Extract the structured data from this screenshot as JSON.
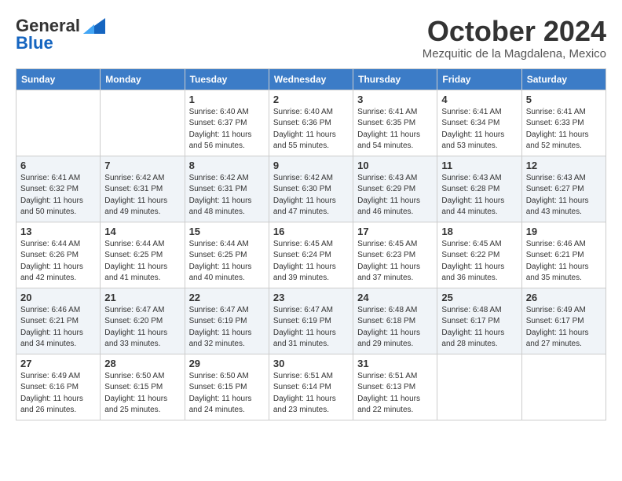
{
  "header": {
    "logo_line1": "General",
    "logo_line2": "Blue",
    "month_title": "October 2024",
    "location": "Mezquitic de la Magdalena, Mexico"
  },
  "days_of_week": [
    "Sunday",
    "Monday",
    "Tuesday",
    "Wednesday",
    "Thursday",
    "Friday",
    "Saturday"
  ],
  "weeks": [
    [
      {
        "day": "",
        "sunrise": "",
        "sunset": "",
        "daylight": ""
      },
      {
        "day": "",
        "sunrise": "",
        "sunset": "",
        "daylight": ""
      },
      {
        "day": "1",
        "sunrise": "Sunrise: 6:40 AM",
        "sunset": "Sunset: 6:37 PM",
        "daylight": "Daylight: 11 hours and 56 minutes."
      },
      {
        "day": "2",
        "sunrise": "Sunrise: 6:40 AM",
        "sunset": "Sunset: 6:36 PM",
        "daylight": "Daylight: 11 hours and 55 minutes."
      },
      {
        "day": "3",
        "sunrise": "Sunrise: 6:41 AM",
        "sunset": "Sunset: 6:35 PM",
        "daylight": "Daylight: 11 hours and 54 minutes."
      },
      {
        "day": "4",
        "sunrise": "Sunrise: 6:41 AM",
        "sunset": "Sunset: 6:34 PM",
        "daylight": "Daylight: 11 hours and 53 minutes."
      },
      {
        "day": "5",
        "sunrise": "Sunrise: 6:41 AM",
        "sunset": "Sunset: 6:33 PM",
        "daylight": "Daylight: 11 hours and 52 minutes."
      }
    ],
    [
      {
        "day": "6",
        "sunrise": "Sunrise: 6:41 AM",
        "sunset": "Sunset: 6:32 PM",
        "daylight": "Daylight: 11 hours and 50 minutes."
      },
      {
        "day": "7",
        "sunrise": "Sunrise: 6:42 AM",
        "sunset": "Sunset: 6:31 PM",
        "daylight": "Daylight: 11 hours and 49 minutes."
      },
      {
        "day": "8",
        "sunrise": "Sunrise: 6:42 AM",
        "sunset": "Sunset: 6:31 PM",
        "daylight": "Daylight: 11 hours and 48 minutes."
      },
      {
        "day": "9",
        "sunrise": "Sunrise: 6:42 AM",
        "sunset": "Sunset: 6:30 PM",
        "daylight": "Daylight: 11 hours and 47 minutes."
      },
      {
        "day": "10",
        "sunrise": "Sunrise: 6:43 AM",
        "sunset": "Sunset: 6:29 PM",
        "daylight": "Daylight: 11 hours and 46 minutes."
      },
      {
        "day": "11",
        "sunrise": "Sunrise: 6:43 AM",
        "sunset": "Sunset: 6:28 PM",
        "daylight": "Daylight: 11 hours and 44 minutes."
      },
      {
        "day": "12",
        "sunrise": "Sunrise: 6:43 AM",
        "sunset": "Sunset: 6:27 PM",
        "daylight": "Daylight: 11 hours and 43 minutes."
      }
    ],
    [
      {
        "day": "13",
        "sunrise": "Sunrise: 6:44 AM",
        "sunset": "Sunset: 6:26 PM",
        "daylight": "Daylight: 11 hours and 42 minutes."
      },
      {
        "day": "14",
        "sunrise": "Sunrise: 6:44 AM",
        "sunset": "Sunset: 6:25 PM",
        "daylight": "Daylight: 11 hours and 41 minutes."
      },
      {
        "day": "15",
        "sunrise": "Sunrise: 6:44 AM",
        "sunset": "Sunset: 6:25 PM",
        "daylight": "Daylight: 11 hours and 40 minutes."
      },
      {
        "day": "16",
        "sunrise": "Sunrise: 6:45 AM",
        "sunset": "Sunset: 6:24 PM",
        "daylight": "Daylight: 11 hours and 39 minutes."
      },
      {
        "day": "17",
        "sunrise": "Sunrise: 6:45 AM",
        "sunset": "Sunset: 6:23 PM",
        "daylight": "Daylight: 11 hours and 37 minutes."
      },
      {
        "day": "18",
        "sunrise": "Sunrise: 6:45 AM",
        "sunset": "Sunset: 6:22 PM",
        "daylight": "Daylight: 11 hours and 36 minutes."
      },
      {
        "day": "19",
        "sunrise": "Sunrise: 6:46 AM",
        "sunset": "Sunset: 6:21 PM",
        "daylight": "Daylight: 11 hours and 35 minutes."
      }
    ],
    [
      {
        "day": "20",
        "sunrise": "Sunrise: 6:46 AM",
        "sunset": "Sunset: 6:21 PM",
        "daylight": "Daylight: 11 hours and 34 minutes."
      },
      {
        "day": "21",
        "sunrise": "Sunrise: 6:47 AM",
        "sunset": "Sunset: 6:20 PM",
        "daylight": "Daylight: 11 hours and 33 minutes."
      },
      {
        "day": "22",
        "sunrise": "Sunrise: 6:47 AM",
        "sunset": "Sunset: 6:19 PM",
        "daylight": "Daylight: 11 hours and 32 minutes."
      },
      {
        "day": "23",
        "sunrise": "Sunrise: 6:47 AM",
        "sunset": "Sunset: 6:19 PM",
        "daylight": "Daylight: 11 hours and 31 minutes."
      },
      {
        "day": "24",
        "sunrise": "Sunrise: 6:48 AM",
        "sunset": "Sunset: 6:18 PM",
        "daylight": "Daylight: 11 hours and 29 minutes."
      },
      {
        "day": "25",
        "sunrise": "Sunrise: 6:48 AM",
        "sunset": "Sunset: 6:17 PM",
        "daylight": "Daylight: 11 hours and 28 minutes."
      },
      {
        "day": "26",
        "sunrise": "Sunrise: 6:49 AM",
        "sunset": "Sunset: 6:17 PM",
        "daylight": "Daylight: 11 hours and 27 minutes."
      }
    ],
    [
      {
        "day": "27",
        "sunrise": "Sunrise: 6:49 AM",
        "sunset": "Sunset: 6:16 PM",
        "daylight": "Daylight: 11 hours and 26 minutes."
      },
      {
        "day": "28",
        "sunrise": "Sunrise: 6:50 AM",
        "sunset": "Sunset: 6:15 PM",
        "daylight": "Daylight: 11 hours and 25 minutes."
      },
      {
        "day": "29",
        "sunrise": "Sunrise: 6:50 AM",
        "sunset": "Sunset: 6:15 PM",
        "daylight": "Daylight: 11 hours and 24 minutes."
      },
      {
        "day": "30",
        "sunrise": "Sunrise: 6:51 AM",
        "sunset": "Sunset: 6:14 PM",
        "daylight": "Daylight: 11 hours and 23 minutes."
      },
      {
        "day": "31",
        "sunrise": "Sunrise: 6:51 AM",
        "sunset": "Sunset: 6:13 PM",
        "daylight": "Daylight: 11 hours and 22 minutes."
      },
      {
        "day": "",
        "sunrise": "",
        "sunset": "",
        "daylight": ""
      },
      {
        "day": "",
        "sunrise": "",
        "sunset": "",
        "daylight": ""
      }
    ]
  ]
}
